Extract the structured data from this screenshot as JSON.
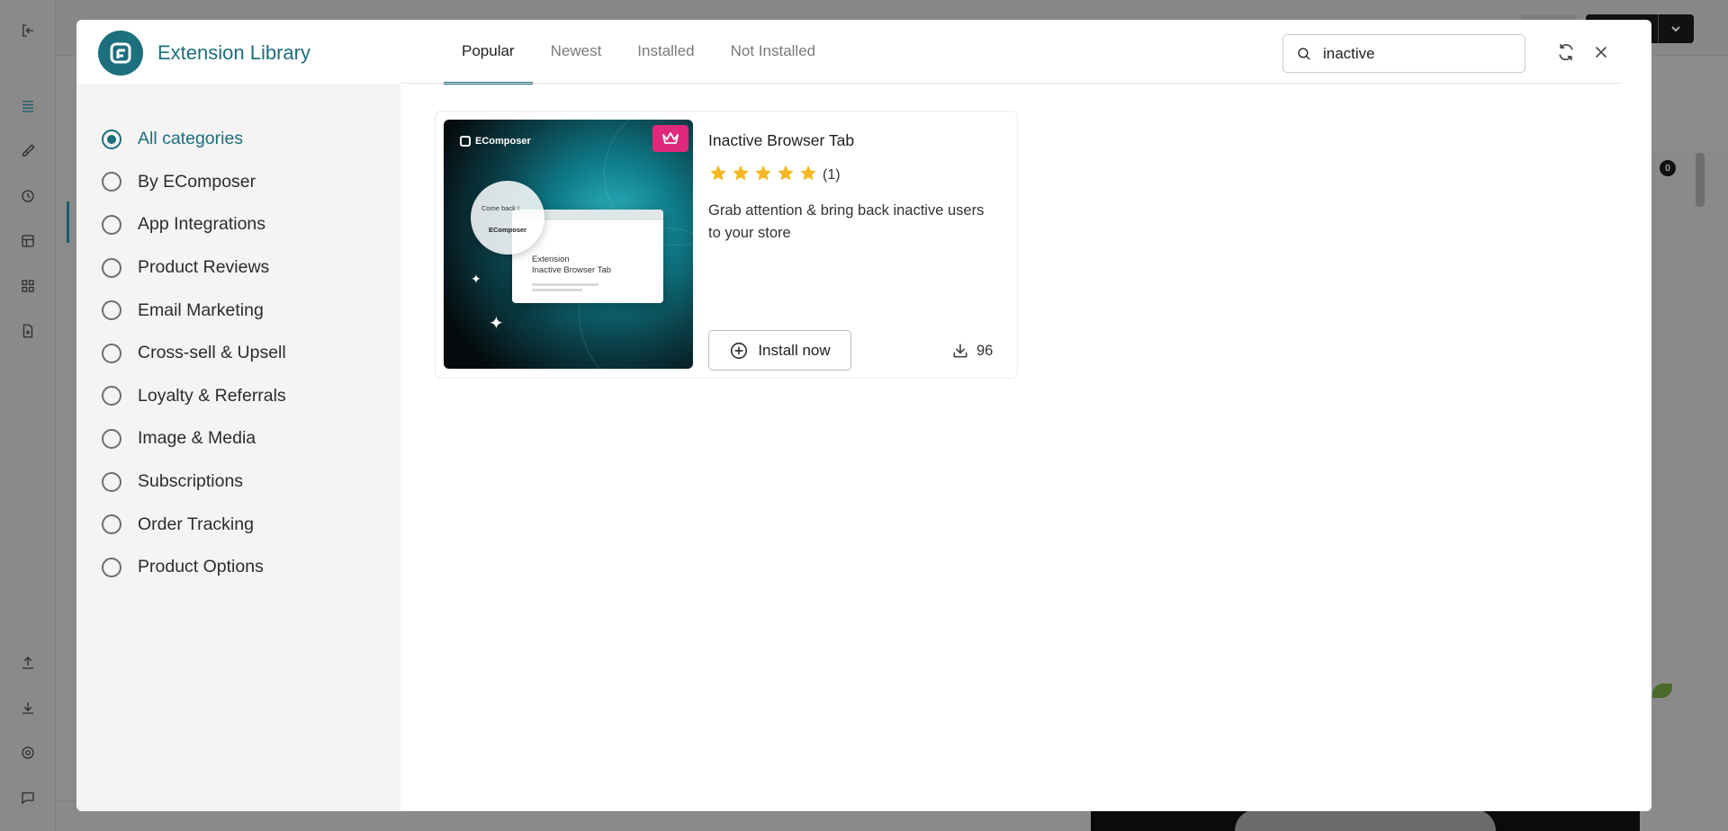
{
  "modal": {
    "title": "Extension Library",
    "tabs": [
      {
        "label": "Popular",
        "active": true
      },
      {
        "label": "Newest",
        "active": false
      },
      {
        "label": "Installed",
        "active": false
      },
      {
        "label": "Not Installed",
        "active": false
      }
    ],
    "search": {
      "value": "inactive",
      "icon": "search-icon"
    },
    "header_actions": [
      {
        "icon": "refresh-icon"
      },
      {
        "icon": "close-icon"
      }
    ],
    "accent_color": "#1c6f7d"
  },
  "categories": {
    "items": [
      {
        "label": "All categories",
        "selected": true
      },
      {
        "label": "By EComposer",
        "selected": false
      },
      {
        "label": "App Integrations",
        "selected": false
      },
      {
        "label": "Product Reviews",
        "selected": false
      },
      {
        "label": "Email Marketing",
        "selected": false
      },
      {
        "label": "Cross-sell & Upsell",
        "selected": false
      },
      {
        "label": "Loyalty & Referrals",
        "selected": false
      },
      {
        "label": "Image & Media",
        "selected": false
      },
      {
        "label": "Subscriptions",
        "selected": false
      },
      {
        "label": "Order Tracking",
        "selected": false
      },
      {
        "label": "Product Options",
        "selected": false
      }
    ]
  },
  "results": [
    {
      "title": "Inactive Browser Tab",
      "rating": 5,
      "rating_count": "(1)",
      "description": "Grab attention & bring back inactive users to your store",
      "install_label": "Install now",
      "downloads": "96",
      "badge_icon": "crown-icon",
      "badge_color": "#e0297a",
      "thumbnail": {
        "brand": "EComposer",
        "window_text_1": "Extension",
        "window_text_2": "Inactive Browser Tab",
        "bubble_text": "Come back !",
        "bubble_brand": "EComposer"
      }
    }
  ],
  "background": {
    "cart_count": "0"
  }
}
